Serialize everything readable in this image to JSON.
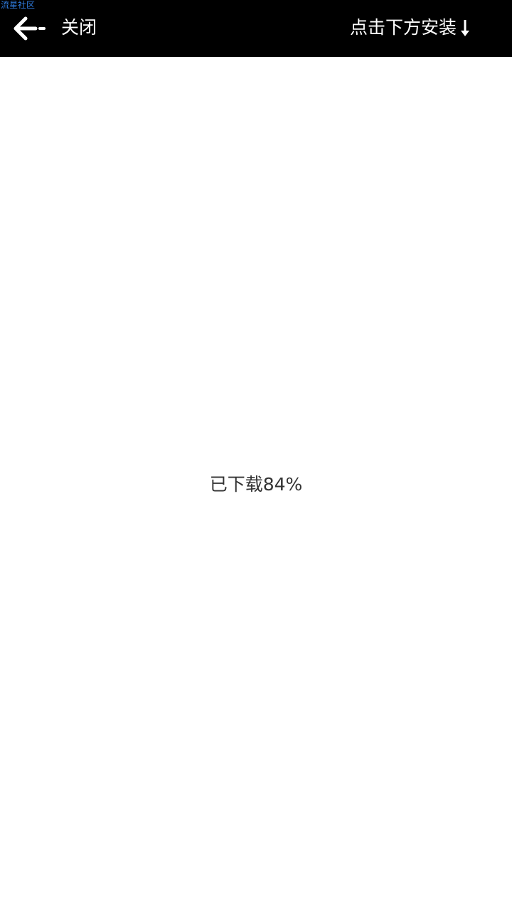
{
  "watermark": {
    "text": "流星社区"
  },
  "topbar": {
    "back_icon": "arrow-left-icon",
    "close_label": "关闭",
    "install_hint": "点击下方安装",
    "install_icon": "arrow-down-icon"
  },
  "download": {
    "status_text": "已下载84%",
    "progress_percent": 84
  },
  "colors": {
    "topbar_bg": "#000000",
    "topbar_text": "#ffffff",
    "body_bg": "#ffffff",
    "status_text": "#333333",
    "watermark": "#2f7de1"
  }
}
